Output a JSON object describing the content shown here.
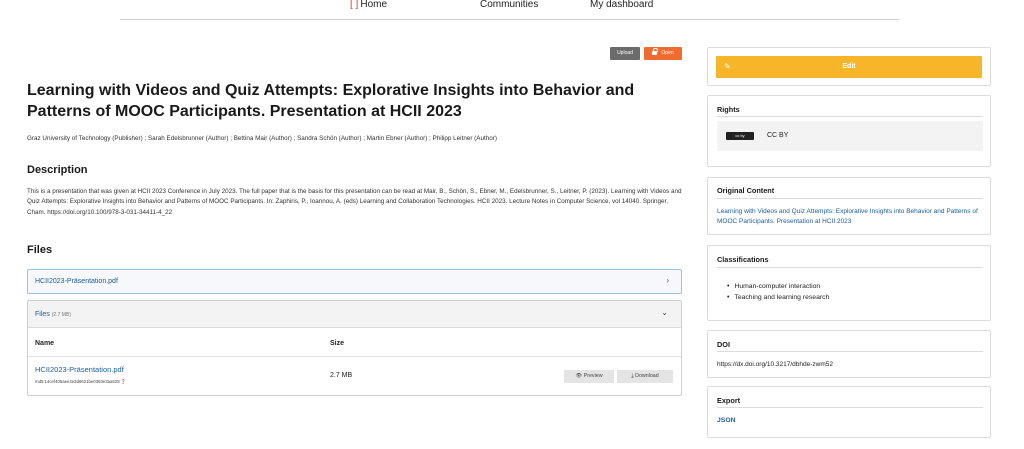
{
  "nav": {
    "home": "Home",
    "communities": "Communities",
    "dashboard": "My dashboard"
  },
  "actions": {
    "upload": "Upload",
    "open": "Open"
  },
  "record": {
    "title": "Learning with Videos and Quiz Attempts: Explorative Insights into Behavior and Patterns of MOOC Participants. Presentation at HCII 2023",
    "authors": "Graz University of Technology (Publisher) ; Sarah Edelsbrunner (Author) ; Bettina Mair (Author) ; Sandra Schön (Author) ; Martin Ebner (Author) ; Philipp Leitner (Author)",
    "description_heading": "Description",
    "description": "This is a presentation that was given at HCII 2023 Conference in July 2023. The full paper that is the basis for this presentation can be read at Mair, B., Schön, S., Ebner, M., Edelsbrunner, S., Leitner, P. (2023). Learning with Videos and Quiz Attempts: Explorative Insights into Behavior and Patterns of MOOC Participants. In: Zaphiris, P., Ioannou, A. (eds) Learning and Collaboration Technologies. HCII 2023. Lecture Notes in Computer Science, vol 14040. Springer, Cham. https://doi.org/10.100/978-3-031-34411-4_22"
  },
  "files": {
    "heading": "Files",
    "preview_file": "HCII2023-Präsentation.pdf",
    "panel_label": "Files",
    "panel_size": "(2.7 MB)",
    "col_name": "Name",
    "col_size": "Size",
    "file_name": "HCII2023-Präsentation.pdf",
    "md5": "md5:14cef405aee4e3d8621be0393e3aa628",
    "file_size": "2.7 MB",
    "preview_btn": "Preview",
    "download_btn": "Download"
  },
  "sidebar": {
    "edit": "Edit",
    "rights_title": "Rights",
    "license": "CC BY",
    "license_badge": "cc by",
    "original_title": "Original Content",
    "original_link": "Learning with Videos and Quiz Attempts: Explorative Insights into Behavior and Patterns of MOOC Participants. Presentation at HCII 2023",
    "classifications_title": "Classifications",
    "classifications": [
      "Human-computer interaction",
      "Teaching and learning research"
    ],
    "doi_title": "DOI",
    "doi": "https://dx.doi.org/10.3217/dbhde-zwm52",
    "export_title": "Export",
    "export_json": "JSON"
  },
  "colors": {
    "accent_link": "#1a5e9b",
    "edit_button": "#f7b52a",
    "open_button": "#ef6b2f",
    "upload_button": "#6b6b6b"
  }
}
